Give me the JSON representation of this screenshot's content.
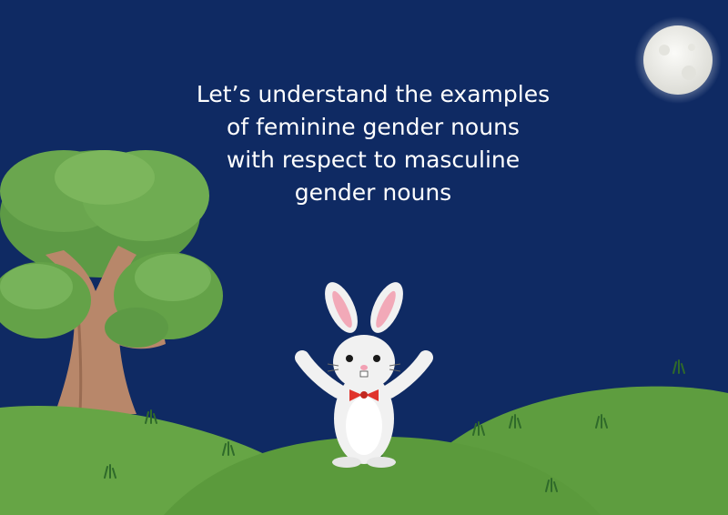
{
  "heading": {
    "line1": "Let’s understand the examples",
    "line2": "of feminine gender nouns",
    "line3": "with respect to masculine",
    "line4": "gender nouns"
  },
  "colors": {
    "sky": "#0f2a63",
    "moon": "#f3f3f1",
    "grass": "#5c9a3c",
    "tree_trunk": "#b8876a",
    "bow_tie": "#e0332c"
  },
  "illustrations": [
    "moon",
    "tree",
    "bunny",
    "grass-hills"
  ]
}
